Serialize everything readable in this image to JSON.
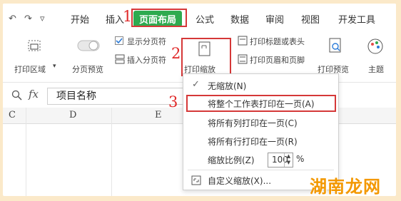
{
  "quick_access": {
    "undo": "↶",
    "redo": "↷",
    "more": "▿"
  },
  "tabs": [
    "开始",
    "插入",
    "页面布局",
    "公式",
    "数据",
    "审阅",
    "视图",
    "开发工具"
  ],
  "active_tab": "页面布局",
  "markers": {
    "m1": "1",
    "m2": "2",
    "m3": "3"
  },
  "ribbon": {
    "print_area": "打印区域",
    "page_break_preview": "分页预览",
    "show_page_break": "显示分页符",
    "insert_page_break": "插入分页符",
    "print_scaling": "打印缩放",
    "print_titles": "打印标题或表头",
    "print_header_footer": "打印页眉和页脚",
    "print_preview": "打印预览",
    "theme": "主题"
  },
  "formula_bar": {
    "fx": "fx",
    "cell_content": "项目名称"
  },
  "columns": [
    "C",
    "D",
    "E"
  ],
  "menu": {
    "items": [
      {
        "label": "无缩放(N)",
        "checked": true
      },
      {
        "label": "将整个工作表打印在一页(A)",
        "highlighted": true
      },
      {
        "label": "将所有列打印在一页(C)"
      },
      {
        "label": "将所有行打印在一页(R)"
      }
    ],
    "zoom_label": "缩放比例(Z)",
    "zoom_value": "100",
    "zoom_unit": "%",
    "custom": "自定义缩放(X)..."
  },
  "watermark": "湖南龙网",
  "colors": {
    "active_tab": "#2eaa4f",
    "highlight_box": "#d53838",
    "marker": "#e02b2b",
    "frame": "#fbe9c9",
    "watermark": "#f39800"
  }
}
